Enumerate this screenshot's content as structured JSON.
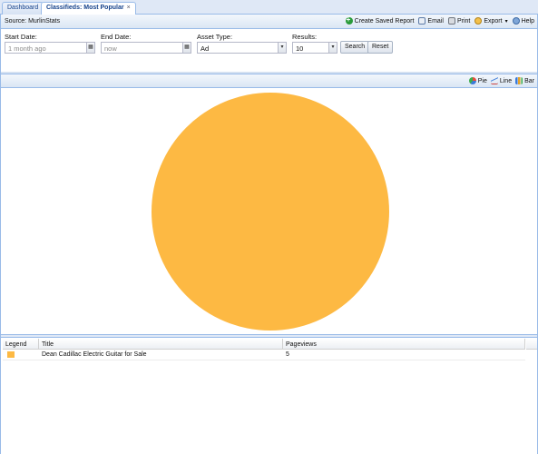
{
  "tabs": [
    {
      "label": "Dashboard",
      "active": false
    },
    {
      "label": "Classifieds: Most Popular",
      "active": true,
      "close": "×"
    }
  ],
  "toolbar": {
    "source": "Source: MurlinStats",
    "create_report": "Create Saved Report",
    "email": "Email",
    "print": "Print",
    "export": "Export",
    "help": "Help"
  },
  "filters": {
    "start_date": {
      "label": "Start Date:",
      "value": "1 month ago"
    },
    "end_date": {
      "label": "End Date:",
      "value": "now"
    },
    "asset_type": {
      "label": "Asset Type:",
      "value": "Ad"
    },
    "results": {
      "label": "Results:",
      "value": "10"
    },
    "search_label": "Search",
    "reset_label": "Reset"
  },
  "chart_types": {
    "pie": "Pie",
    "line": "Line",
    "bar": "Bar"
  },
  "chart_data": {
    "type": "pie",
    "title": "",
    "categories": [
      "Dean Cadillac Electric Guitar for Sale"
    ],
    "values": [
      5
    ],
    "colors": [
      "#fdb943"
    ]
  },
  "grid": {
    "columns": [
      "Legend",
      "Title",
      "Pageviews"
    ],
    "rows": [
      {
        "color": "#fdb943",
        "title": "Dean Cadillac Electric Guitar for Sale",
        "pageviews": "5"
      }
    ]
  }
}
